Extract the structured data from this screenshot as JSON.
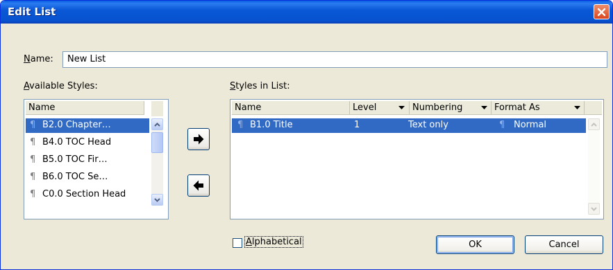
{
  "window": {
    "title": "Edit List"
  },
  "name_field": {
    "label_underlined": "N",
    "label_rest": "ame:",
    "value": "New List"
  },
  "available_styles": {
    "label_underlined": "A",
    "label_rest": "vailable Styles:",
    "column_header": "Name",
    "items": [
      {
        "label": "B2.0 Chapter…"
      },
      {
        "label": "B4.0 TOC Head"
      },
      {
        "label": "B5.0 TOC Fir…"
      },
      {
        "label": "B6.0 TOC Se…"
      },
      {
        "label": "C0.0 Section Head"
      }
    ]
  },
  "styles_in_list": {
    "label_underlined": "S",
    "label_rest": "tyles in List:",
    "columns": {
      "name": "Name",
      "level": "Level",
      "numbering": "Numbering",
      "format_as": "Format As"
    },
    "rows": [
      {
        "name": "B1.0 Title",
        "level": "1",
        "numbering": "Text only",
        "format_as": "Normal"
      }
    ]
  },
  "options": {
    "alphabetical_underlined": "A",
    "alphabetical_rest": "lphabetical",
    "alphabetical_checked": false
  },
  "buttons": {
    "ok": "OK",
    "cancel": "Cancel",
    "add_icon": "right-arrow-icon",
    "remove_icon": "left-arrow-icon"
  },
  "colors": {
    "titlebar": "#0a58d6",
    "selection": "#316ac5",
    "dialog": "#ece9d8"
  }
}
